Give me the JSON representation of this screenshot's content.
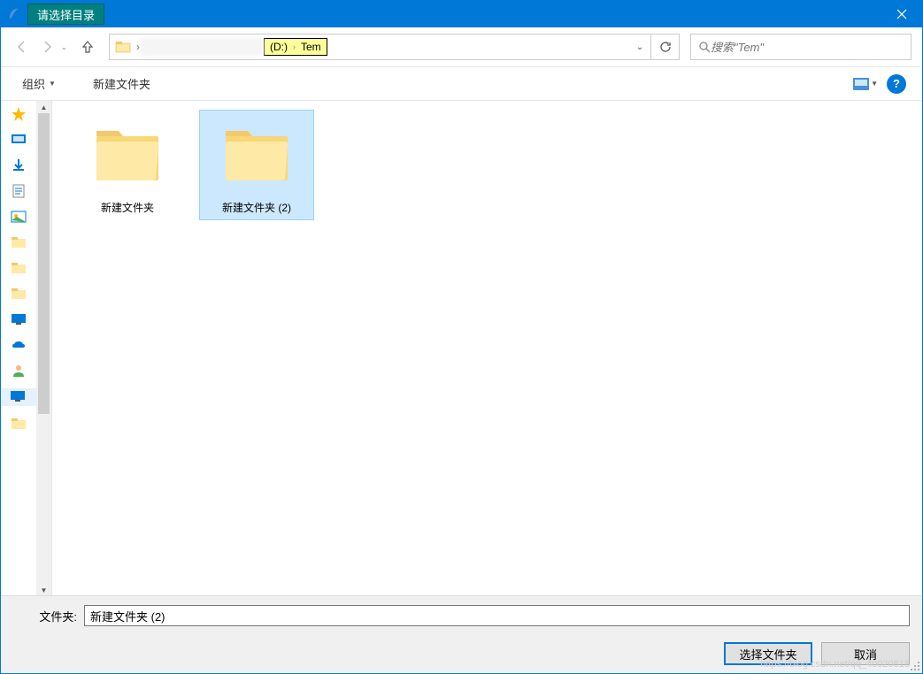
{
  "window": {
    "title": "请选择目录"
  },
  "address": {
    "drive": "(D:)",
    "folder": "Tem"
  },
  "search": {
    "placeholder": "搜索\"Tem\""
  },
  "toolbar": {
    "organize": "组织",
    "new_folder": "新建文件夹"
  },
  "folders": [
    {
      "name": "新建文件夹",
      "selected": false
    },
    {
      "name": "新建文件夹 (2)",
      "selected": true
    }
  ],
  "footer": {
    "label": "文件夹:",
    "value": "新建文件夹 (2)",
    "select_btn": "选择文件夹",
    "cancel_btn": "取消"
  },
  "watermark": "https://blog.csdn.net/qq_40020818"
}
